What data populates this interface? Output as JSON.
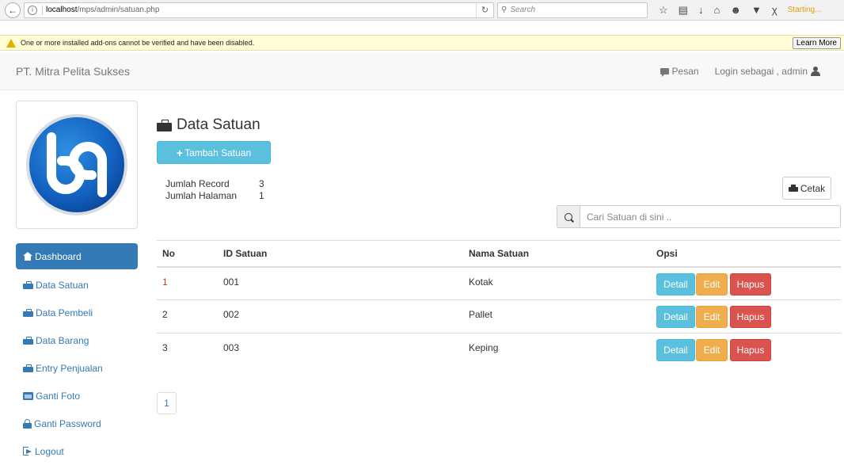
{
  "browser": {
    "url_host": "localhost",
    "url_path": "/mps/admin/satuan.php",
    "search_placeholder": "Search",
    "status_text": "Starting..."
  },
  "notification": {
    "message": "One or more installed add-ons cannot be verified and have been disabled.",
    "learn_more": "Learn More"
  },
  "navbar": {
    "brand": "PT. Mitra Pelita Sukses",
    "messages_label": "Pesan",
    "login_label": "Login sebagai , admin"
  },
  "sidebar": {
    "items": [
      {
        "label": "Dashboard",
        "icon": "home-icon"
      },
      {
        "label": "Data Satuan",
        "icon": "briefcase-icon"
      },
      {
        "label": "Data Pembeli",
        "icon": "briefcase-icon"
      },
      {
        "label": "Data Barang",
        "icon": "briefcase-icon"
      },
      {
        "label": "Entry Penjualan",
        "icon": "briefcase-icon"
      },
      {
        "label": "Ganti Foto",
        "icon": "picture-icon"
      },
      {
        "label": "Ganti Password",
        "icon": "lock-icon"
      },
      {
        "label": "Logout",
        "icon": "logout-icon"
      }
    ]
  },
  "main": {
    "title": "Data Satuan",
    "add_button": "Tambah Satuan",
    "stats": {
      "record_label": "Jumlah Record",
      "record_value": "3",
      "pages_label": "Jumlah Halaman",
      "pages_value": "1"
    },
    "print_button": "Cetak",
    "search_placeholder": "Cari Satuan di sini ..",
    "table": {
      "headers": [
        "No",
        "ID Satuan",
        "Nama Satuan",
        "Opsi"
      ],
      "rows": [
        {
          "no": "1",
          "id": "001",
          "nama": "Kotak"
        },
        {
          "no": "2",
          "id": "002",
          "nama": "Pallet"
        },
        {
          "no": "3",
          "id": "003",
          "nama": "Keping"
        }
      ],
      "actions": {
        "detail": "Detail",
        "edit": "Edit",
        "hapus": "Hapus"
      }
    },
    "pagination": [
      "1"
    ]
  },
  "colors": {
    "primary": "#337ab7",
    "info": "#5bc0de",
    "warning": "#f0ad4e",
    "danger": "#d9534f"
  }
}
